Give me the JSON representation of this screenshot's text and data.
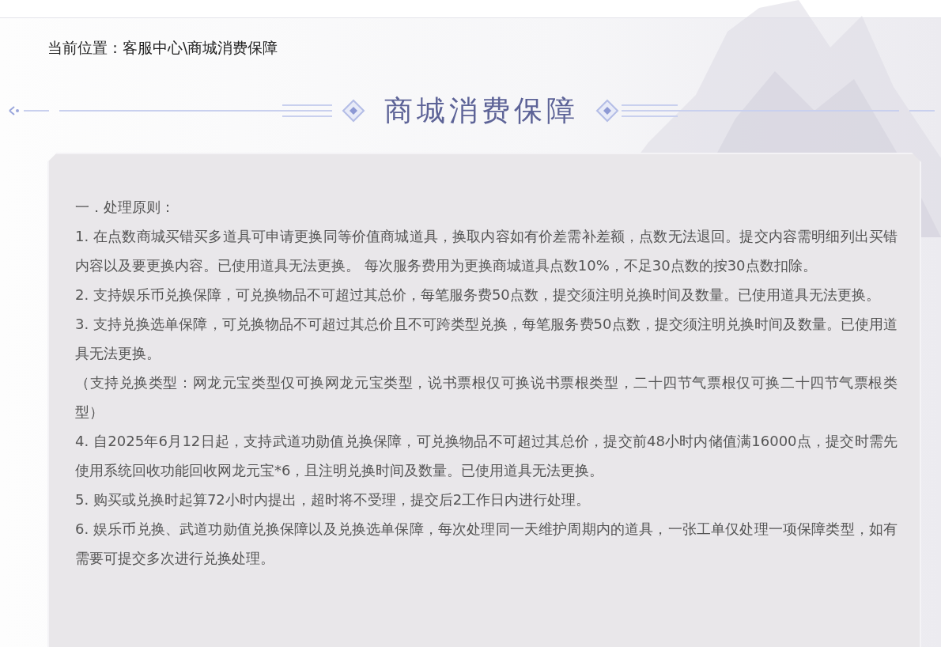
{
  "breadcrumb": "当前位置：客服中心\\商城消费保障",
  "title": "商城消费保障",
  "panel": {
    "heading": "一．处理原则：",
    "paragraphs": [
      "1. 在点数商城买错买多道具可申请更换同等价值商城道具，换取内容如有价差需补差额，点数无法退回。提交内容需明细列出买错内容以及要更换内容。已使用道具无法更换。 每次服务费用为更换商城道具点数10%，不足30点数的按30点数扣除。",
      "2. 支持娱乐币兑换保障，可兑换物品不可超过其总价，每笔服务费50点数，提交须注明兑换时间及数量。已使用道具无法更换。",
      "3. 支持兑换选单保障，可兑换物品不可超过其总价且不可跨类型兑换，每笔服务费50点数，提交须注明兑换时间及数量。已使用道具无法更换。",
      "（支持兑换类型：网龙元宝类型仅可换网龙元宝类型，说书票根仅可换说书票根类型，二十四节气票根仅可换二十四节气票根类型）",
      "4. 自2025年6月12日起，支持武道功勋值兑换保障，可兑换物品不可超过其总价，提交前48小时内储值满16000点，提交时需先使用系统回收功能回收网龙元宝*6，且注明兑换时间及数量。已使用道具无法更换。",
      "5. 购买或兑换时起算72小时内提出，超时将不受理，提交后2工作日内进行处理。",
      "6. 娱乐币兑换、武道功勋值兑换保障以及兑换选单保障，每次处理同一天维护周期内的道具，一张工单仅处理一项保障类型，如有需要可提交多次进行兑换处理。"
    ]
  }
}
